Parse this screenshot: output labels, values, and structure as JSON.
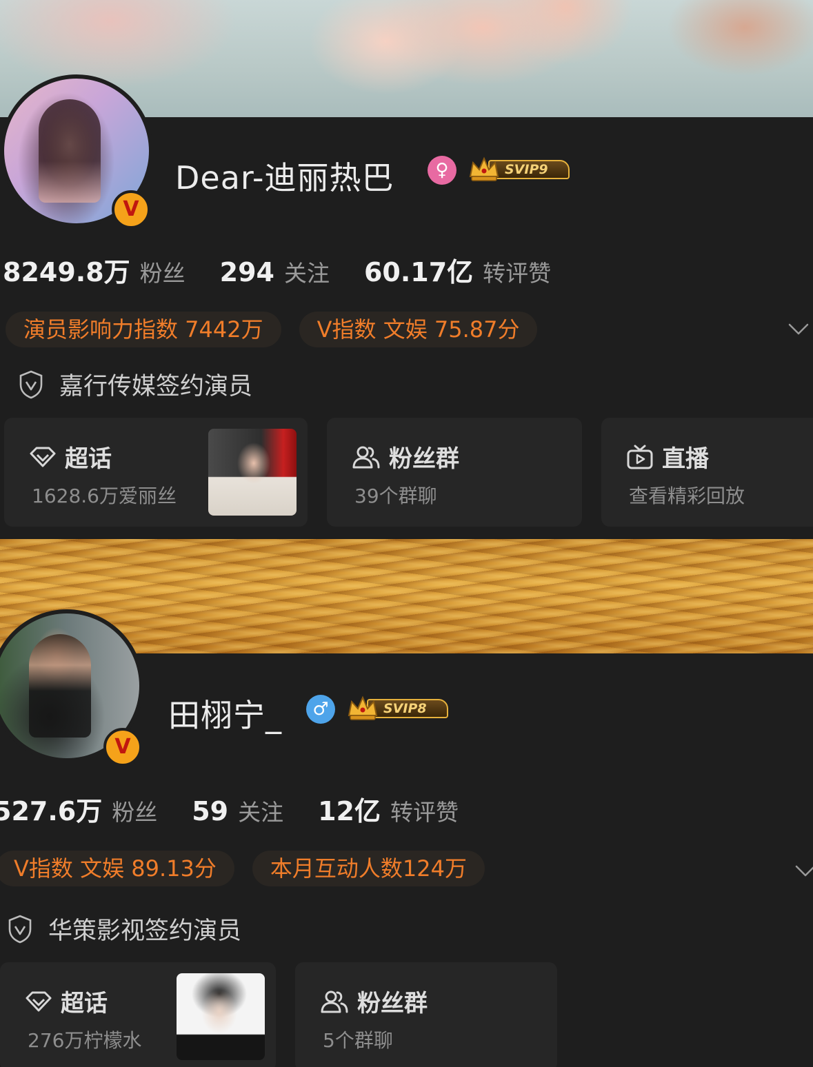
{
  "profiles": [
    {
      "name": "Dear-迪丽热巴",
      "gender_icon": "female-icon",
      "gender_symbol": "♀",
      "svip": "SVIP9",
      "stats": [
        {
          "value": "8249.8万",
          "label": "粉丝"
        },
        {
          "value": "294",
          "label": "关注"
        },
        {
          "value": "60.17亿",
          "label": "转评赞"
        }
      ],
      "tags": [
        "演员影响力指数 7442万",
        "V指数 文娱 75.87分"
      ],
      "certification": "嘉行传媒签约演员",
      "cards": [
        {
          "title": "超话",
          "subtitle": "1628.6万爱丽丝",
          "icon": "super-topic-icon"
        },
        {
          "title": "粉丝群",
          "subtitle": "39个群聊",
          "icon": "fan-group-icon"
        },
        {
          "title": "直播",
          "subtitle": "查看精彩回放",
          "icon": "live-tv-icon"
        }
      ]
    },
    {
      "name": "田栩宁_",
      "gender_icon": "male-icon",
      "gender_symbol": "♂",
      "svip": "SVIP8",
      "stats": [
        {
          "value": "527.6万",
          "label": "粉丝"
        },
        {
          "value": "59",
          "label": "关注"
        },
        {
          "value": "12亿",
          "label": "转评赞"
        }
      ],
      "tags": [
        "V指数 文娱 89.13分",
        "本月互动人数124万"
      ],
      "certification": "华策影视签约演员",
      "cards": [
        {
          "title": "超话",
          "subtitle": "276万柠檬水",
          "icon": "super-topic-icon"
        },
        {
          "title": "粉丝群",
          "subtitle": "5个群聊",
          "icon": "fan-group-icon"
        }
      ]
    }
  ],
  "verified_badge": "V",
  "colors": {
    "accent": "#f07d2a",
    "background": "#1e1e1e",
    "card": "#262626",
    "verified": "#f5a21a"
  }
}
